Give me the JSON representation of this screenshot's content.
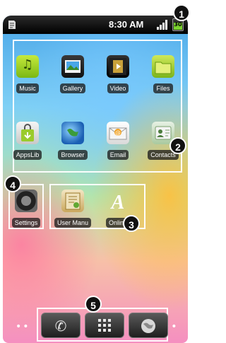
{
  "status_bar": {
    "time": "8:30 AM",
    "battery_level": "30"
  },
  "apps": {
    "music": "Music",
    "gallery": "Gallery",
    "video": "Video",
    "files": "Files",
    "appslib": "AppsLib",
    "browser": "Browser",
    "email": "Email",
    "contacts": "Contacts",
    "settings": "Settings",
    "user_manual": "User Manu",
    "online": "Online"
  },
  "callouts": {
    "one": "1",
    "two": "2",
    "three": "3",
    "four": "4",
    "five": "5"
  },
  "icons": {
    "music": "music-note-icon",
    "gallery": "photo-icon",
    "video": "film-icon",
    "files": "folder-icon",
    "appslib": "shopping-bag-icon",
    "browser": "globe-icon",
    "email": "envelope-icon",
    "contacts": "contact-card-icon",
    "settings": "gear-icon",
    "user_manual": "book-icon",
    "online": "letter-a-icon",
    "dock_phone": "phone-icon",
    "dock_apps": "app-grid-icon",
    "dock_browser": "globe-icon"
  }
}
